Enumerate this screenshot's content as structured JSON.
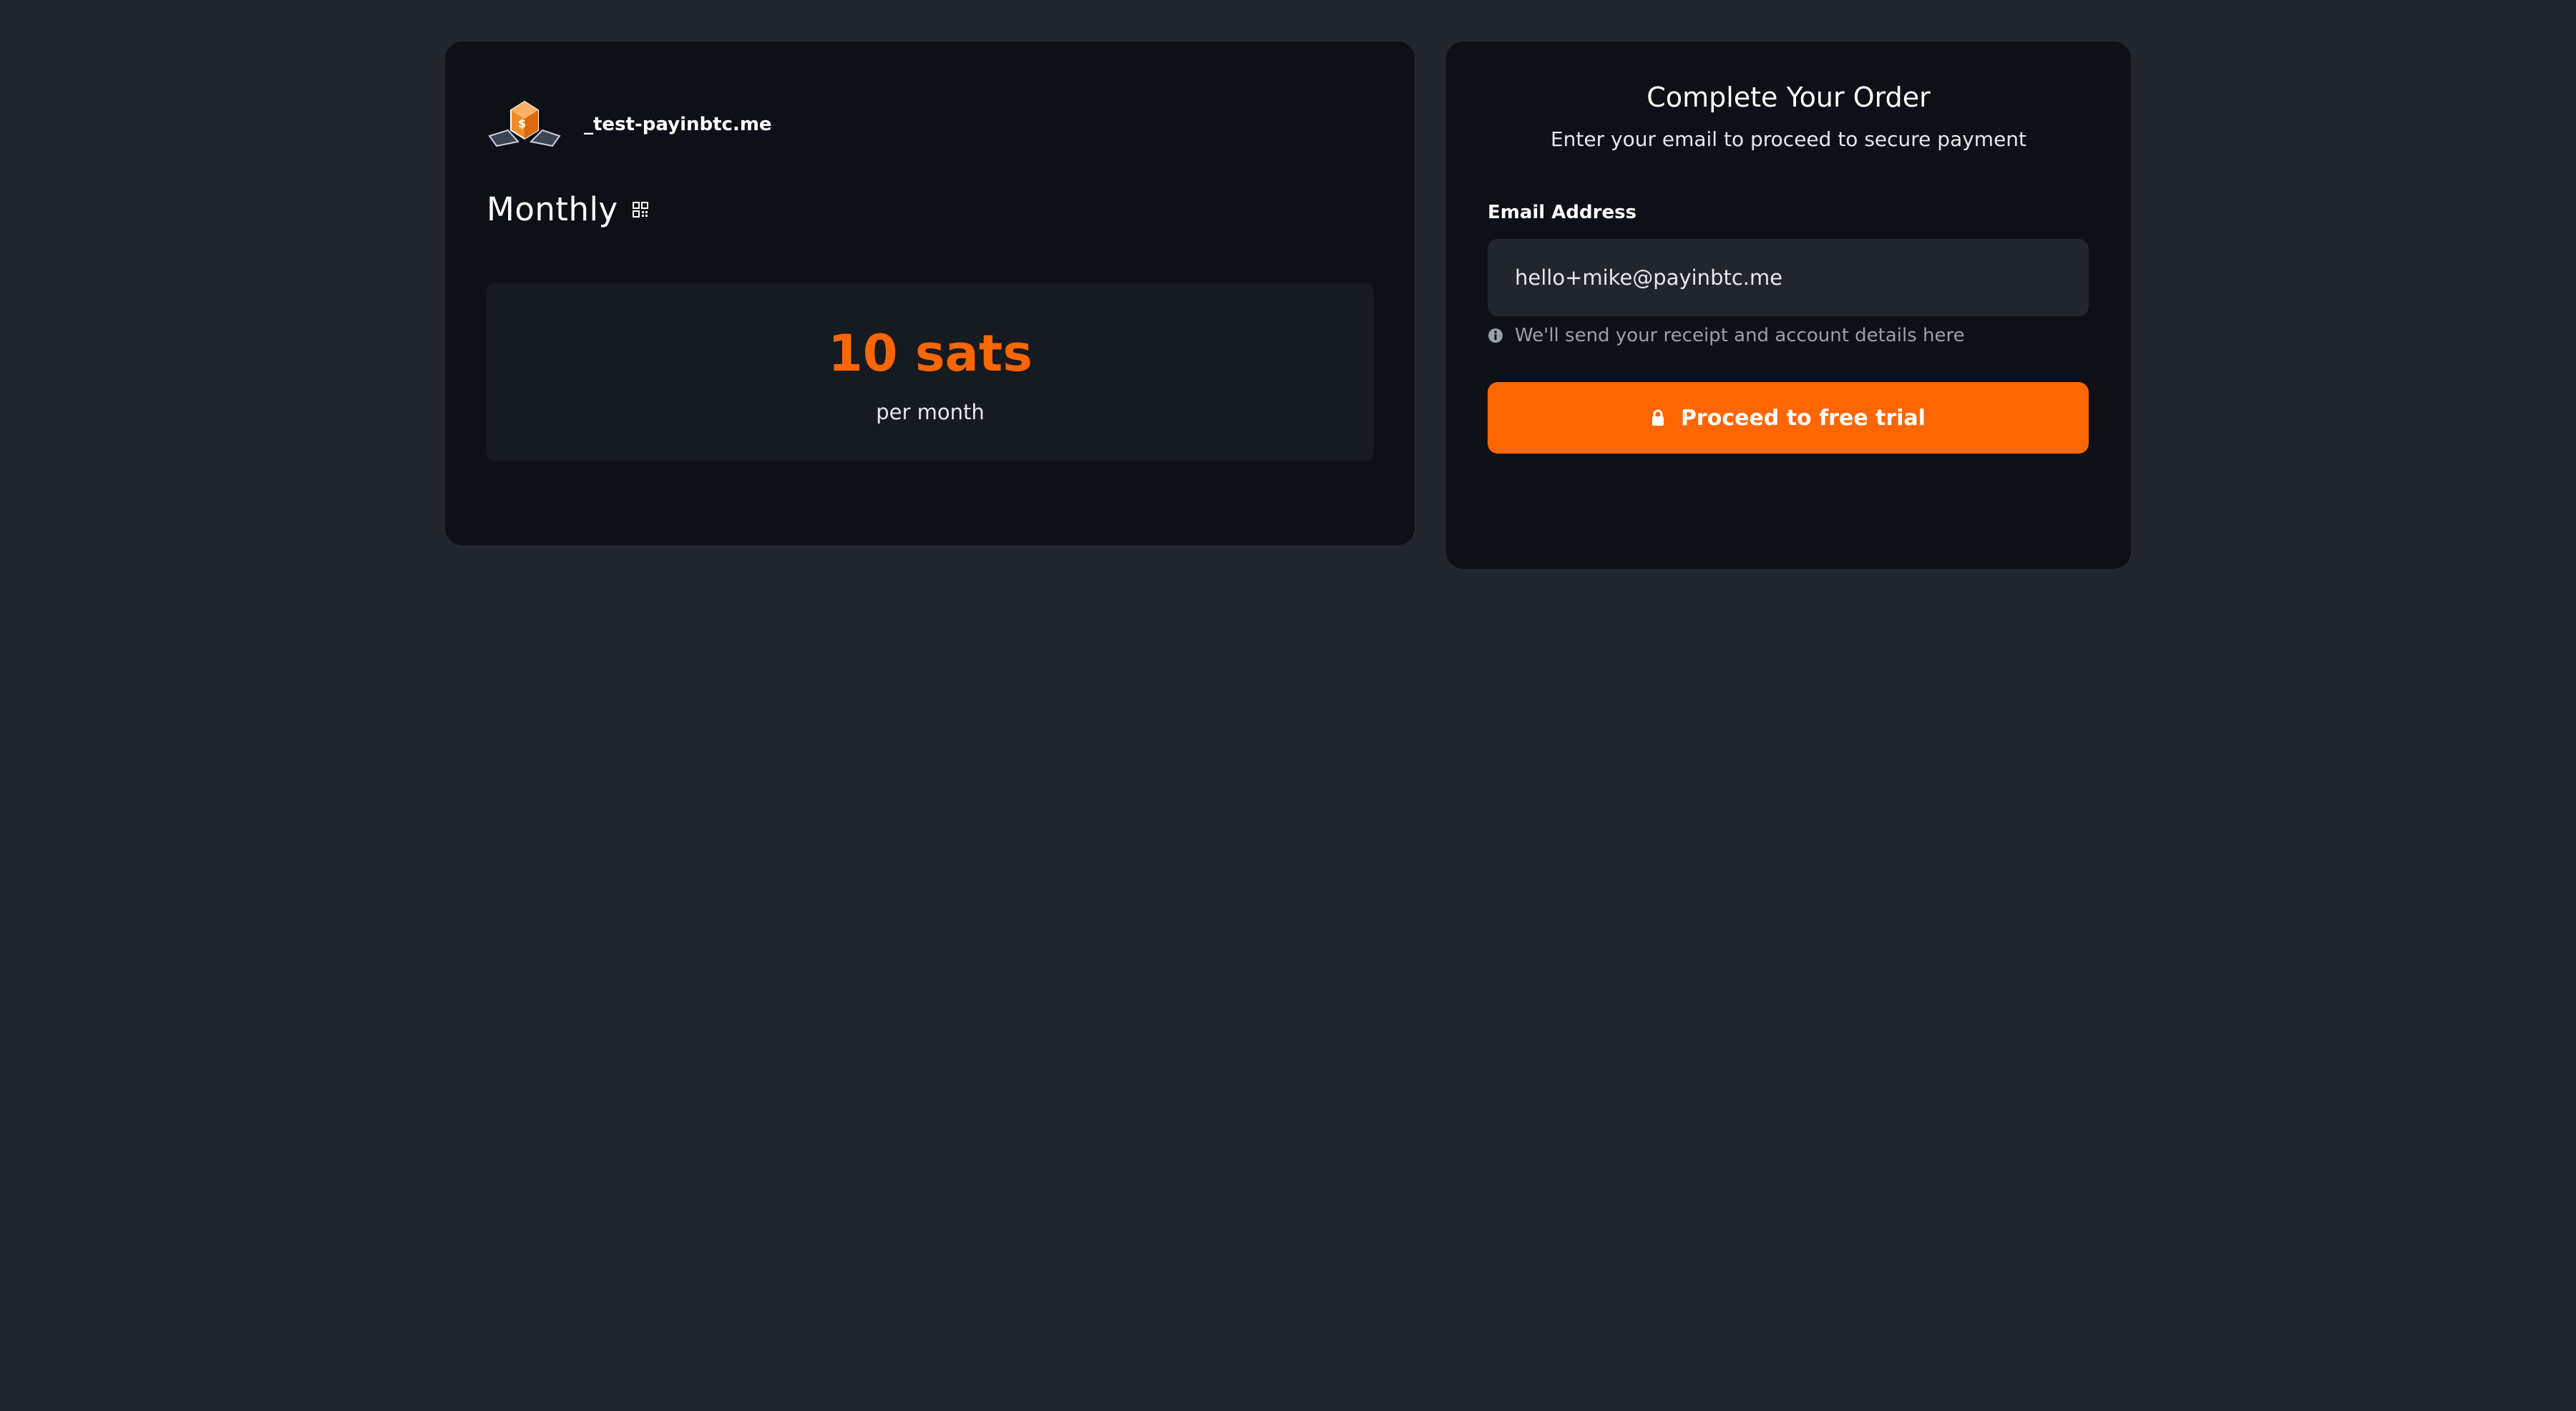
{
  "merchant": {
    "name": "_test-payinbtc.me",
    "logo_icon": "payinbtc-logo-icon"
  },
  "plan": {
    "name": "Monthly",
    "qr_icon": "qr-code-icon",
    "price": "10 sats",
    "period": "per month"
  },
  "order": {
    "title": "Complete Your Order",
    "subtitle": "Enter your email to proceed to secure payment",
    "email_label": "Email Address",
    "email_value": "hello+mike@payinbtc.me",
    "hint": "We'll send your receipt and account details here",
    "hint_icon": "info-icon",
    "button_label": "Proceed to free trial",
    "button_icon": "lock-icon"
  },
  "colors": {
    "background": "#21252d",
    "card": "#0d1016",
    "accent": "#ff6600",
    "muted_text": "#9aa0a8"
  }
}
